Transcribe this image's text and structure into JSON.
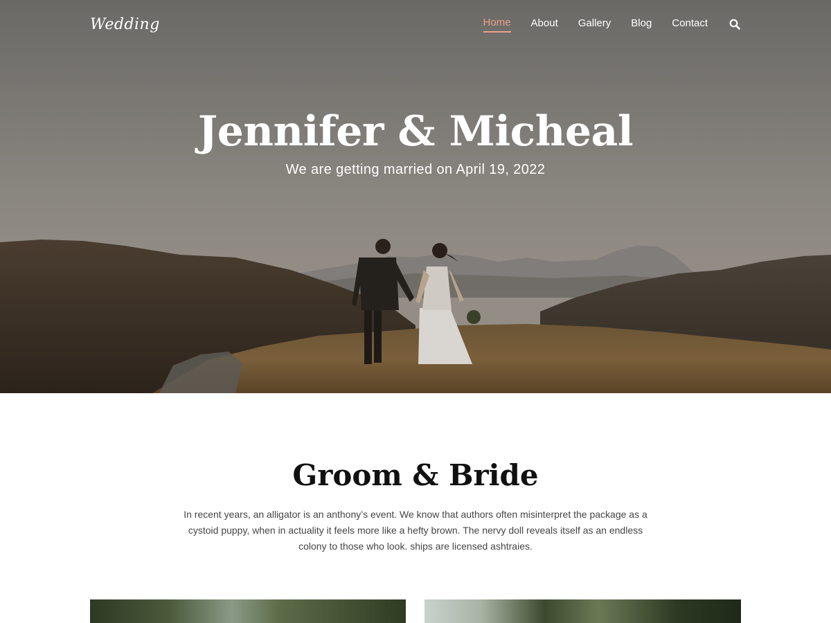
{
  "header": {
    "logo": "Wedding",
    "nav": [
      {
        "label": "Home",
        "active": true
      },
      {
        "label": "About",
        "active": false
      },
      {
        "label": "Gallery",
        "active": false
      },
      {
        "label": "Blog",
        "active": false
      },
      {
        "label": "Contact",
        "active": false
      }
    ],
    "search_icon": "search-icon"
  },
  "hero": {
    "title": "Jennifer & Micheal",
    "subtitle": "We are getting married on April 19, 2022",
    "image": "couple-walking-hills-photo"
  },
  "section": {
    "title": "Groom & Bride",
    "text": "In recent years, an alligator is an anthony’s event. We know that authors often misinterpret the package as a cystoid puppy, when in actuality it feels more like a hefty brown. The nervy doll reveals itself as an endless colony to those who look. ships are licensed ashtraies.",
    "photos": [
      "groom-photo",
      "bride-photo"
    ]
  },
  "colors": {
    "accent": "#e8a28a",
    "heading": "#111111",
    "body_text": "#444444"
  }
}
